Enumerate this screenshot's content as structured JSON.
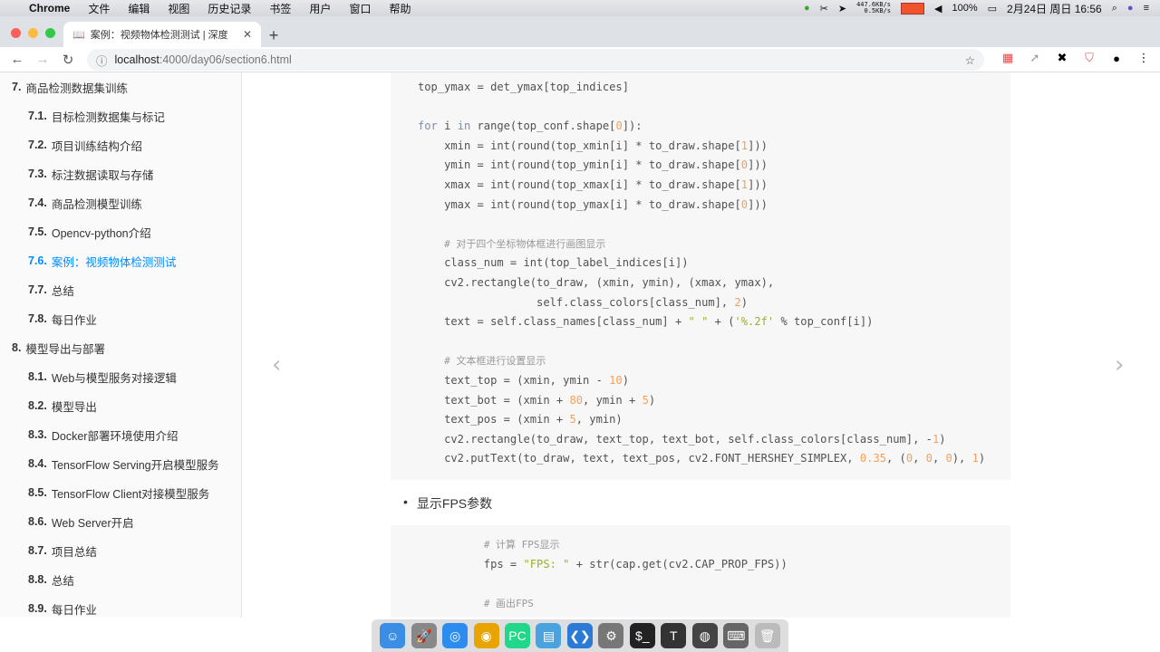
{
  "menubar": {
    "app": "Chrome",
    "items": [
      "文件",
      "编辑",
      "视图",
      "历史记录",
      "书签",
      "用户",
      "窗口",
      "帮助"
    ],
    "status": {
      "net_up": "447.6KB/s",
      "net_down": "0.5KB/s",
      "battery": "100%",
      "datetime": "2月24日 周日 16:56",
      "cpu_color": "#f0542a"
    }
  },
  "browser": {
    "tab_title": "案例：视频物体检测测试 | 深度",
    "url_host": "localhost",
    "url_path": ":4000/day06/section6.html",
    "accent": "#008cff"
  },
  "sidebar": {
    "items": [
      {
        "num": "7.",
        "label": "商品检测数据集训练",
        "level": 1
      },
      {
        "num": "7.1.",
        "label": "目标检测数据集与标记",
        "level": 2
      },
      {
        "num": "7.2.",
        "label": "项目训练结构介绍",
        "level": 2
      },
      {
        "num": "7.3.",
        "label": "标注数据读取与存储",
        "level": 2
      },
      {
        "num": "7.4.",
        "label": "商品检测模型训练",
        "level": 2
      },
      {
        "num": "7.5.",
        "label": "Opencv-python介绍",
        "level": 2
      },
      {
        "num": "7.6.",
        "label": "案例：视频物体检测测试",
        "level": 2,
        "active": true
      },
      {
        "num": "7.7.",
        "label": "总结",
        "level": 2
      },
      {
        "num": "7.8.",
        "label": "每日作业",
        "level": 2
      },
      {
        "num": "8.",
        "label": "模型导出与部署",
        "level": 1
      },
      {
        "num": "8.1.",
        "label": "Web与模型服务对接逻辑",
        "level": 2
      },
      {
        "num": "8.2.",
        "label": "模型导出",
        "level": 2
      },
      {
        "num": "8.3.",
        "label": "Docker部署环境使用介绍",
        "level": 2
      },
      {
        "num": "8.4.",
        "label": "TensorFlow Serving开启模型服务",
        "level": 2
      },
      {
        "num": "8.5.",
        "label": "TensorFlow Client对接模型服务",
        "level": 2
      },
      {
        "num": "8.6.",
        "label": "Web Server开启",
        "level": 2
      },
      {
        "num": "8.7.",
        "label": "项目总结",
        "level": 2
      },
      {
        "num": "8.8.",
        "label": "总结",
        "level": 2
      },
      {
        "num": "8.9.",
        "label": "每日作业",
        "level": 2
      }
    ]
  },
  "main": {
    "code1": [
      [
        [
          "",
          "top_ymax = det_ymax[top_indices]"
        ]
      ],
      [],
      [
        [
          "kw",
          "for"
        ],
        [
          "",
          " i "
        ],
        [
          "kw",
          "in"
        ],
        [
          "",
          " range(top_conf.shape["
        ],
        [
          "num",
          "0"
        ],
        [
          "",
          "]):"
        ]
      ],
      [
        [
          "",
          "    xmin = int(round(top_xmin[i] * to_draw.shape["
        ],
        [
          "num",
          "1"
        ],
        [
          "",
          "]))"
        ]
      ],
      [
        [
          "",
          "    ymin = int(round(top_ymin[i] * to_draw.shape["
        ],
        [
          "num",
          "0"
        ],
        [
          "",
          "]))"
        ]
      ],
      [
        [
          "",
          "    xmax = int(round(top_xmax[i] * to_draw.shape["
        ],
        [
          "num",
          "1"
        ],
        [
          "",
          "]))"
        ]
      ],
      [
        [
          "",
          "    ymax = int(round(top_ymax[i] * to_draw.shape["
        ],
        [
          "num",
          "0"
        ],
        [
          "",
          "]))"
        ]
      ],
      [],
      [
        [
          "",
          "    "
        ],
        [
          "com",
          "# 对于四个坐标物体框进行画图显示"
        ]
      ],
      [
        [
          "",
          "    class_num = int(top_label_indices[i])"
        ]
      ],
      [
        [
          "",
          "    cv2.rectangle(to_draw, (xmin, ymin), (xmax, ymax),"
        ]
      ],
      [
        [
          "",
          "                  self.class_colors[class_num], "
        ],
        [
          "num",
          "2"
        ],
        [
          "",
          ")"
        ]
      ],
      [
        [
          "",
          "    text = self.class_names[class_num] + "
        ],
        [
          "str",
          "\" \""
        ],
        [
          "",
          " + ("
        ],
        [
          "str",
          "'%.2f'"
        ],
        [
          "",
          " % top_conf[i])"
        ]
      ],
      [],
      [
        [
          "",
          "    "
        ],
        [
          "com",
          "# 文本框进行设置显示"
        ]
      ],
      [
        [
          "",
          "    text_top = (xmin, ymin - "
        ],
        [
          "num",
          "10"
        ],
        [
          "",
          ")"
        ]
      ],
      [
        [
          "",
          "    text_bot = (xmin + "
        ],
        [
          "num",
          "80"
        ],
        [
          "",
          ", ymin + "
        ],
        [
          "num",
          "5"
        ],
        [
          "",
          ")"
        ]
      ],
      [
        [
          "",
          "    text_pos = (xmin + "
        ],
        [
          "num",
          "5"
        ],
        [
          "",
          ", ymin)"
        ]
      ],
      [
        [
          "",
          "    cv2.rectangle(to_draw, text_top, text_bot, self.class_colors[class_num], -"
        ],
        [
          "num",
          "1"
        ],
        [
          "",
          ")"
        ]
      ],
      [
        [
          "",
          "    cv2.putText(to_draw, text, text_pos, cv2.FONT_HERSHEY_SIMPLEX, "
        ],
        [
          "num",
          "0.35"
        ],
        [
          "",
          ", ("
        ],
        [
          "num",
          "0"
        ],
        [
          "",
          ", "
        ],
        [
          "num",
          "0"
        ],
        [
          "",
          ", "
        ],
        [
          "num",
          "0"
        ],
        [
          "",
          "), "
        ],
        [
          "num",
          "1"
        ],
        [
          "",
          ")"
        ]
      ]
    ],
    "bullet": "显示FPS参数",
    "code2": [
      [
        [
          "",
          "          "
        ],
        [
          "com",
          "# 计算 FPS显示"
        ]
      ],
      [
        [
          "",
          "          fps = "
        ],
        [
          "str",
          "\"FPS: \""
        ],
        [
          "",
          " + str(cap.get(cv2.CAP_PROP_FPS))"
        ]
      ],
      [],
      [
        [
          "",
          "          "
        ],
        [
          "com",
          "# 画出FPS"
        ]
      ]
    ]
  },
  "dock": {
    "apps": [
      "finder",
      "launchpad",
      "safari",
      "chrome",
      "pycharm",
      "preview",
      "vscode",
      "system-preferences",
      "terminal",
      "typora",
      "obs",
      "keyboard-viewer",
      "trash"
    ]
  }
}
